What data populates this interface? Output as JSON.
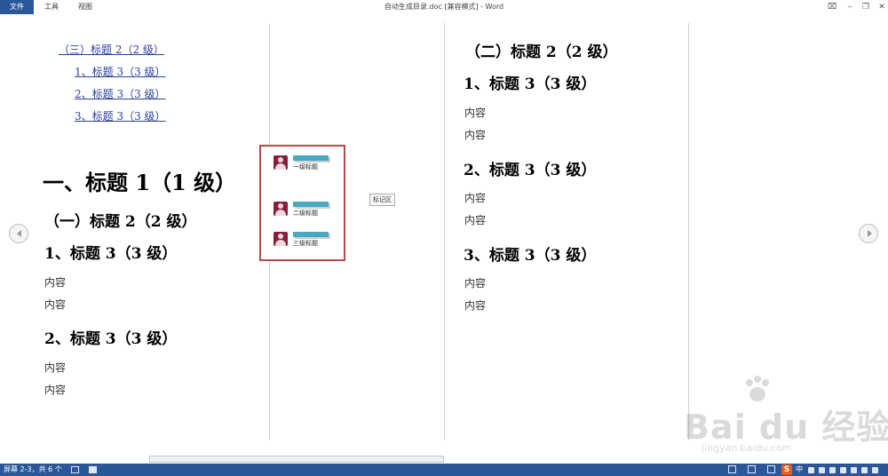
{
  "menu": {
    "file": "文件",
    "tools": "工具",
    "view": "视图"
  },
  "window": {
    "title": "自动生成目录.doc [兼容模式] - Word",
    "opts": "⌧",
    "minimize": "–",
    "restore": "❐",
    "close": "✕"
  },
  "toc": [
    {
      "label": "（三）标题 2（2 级）"
    },
    {
      "label": "1、标题 3（3 级）"
    },
    {
      "label": "2、标题 3（3 级）"
    },
    {
      "label": "3、标题 3（3 级）"
    }
  ],
  "left_page": {
    "h1": "一、标题 1（1 级）",
    "h2": "（一）标题 2（2 级）",
    "sections": [
      {
        "heading": "1、标题 3（3 级）",
        "lines": [
          "内容",
          "内容"
        ]
      },
      {
        "heading": "2、标题 3（3 级）",
        "lines": [
          "内容",
          "内容"
        ]
      }
    ]
  },
  "right_page": {
    "h2": "（二）标题 2（2 级）",
    "sections": [
      {
        "heading": "1、标题 3（3 级）",
        "lines": [
          "内容",
          "内容"
        ]
      },
      {
        "heading": "2、标题 3（3 级）",
        "lines": [
          "内容",
          "内容"
        ]
      },
      {
        "heading": "3、标题 3（3 级）",
        "lines": [
          "内容",
          "内容"
        ]
      }
    ]
  },
  "annotation": {
    "items": [
      {
        "label": "一级标题"
      },
      {
        "label": "二级标题"
      },
      {
        "label": "三级标题"
      }
    ],
    "tag": "标记区",
    "border_color": "#b94a48",
    "bubble_color": "#4aa8c0"
  },
  "status": {
    "pages": "屏幕 2-3，共 6 个"
  },
  "tray": {
    "ime": "S",
    "lang": "中"
  },
  "watermark": {
    "logo": "Bai du 经验",
    "sub": "jingyan.baidu.com"
  },
  "colors": {
    "accent": "#2b579a",
    "link": "#2a3fa0"
  }
}
